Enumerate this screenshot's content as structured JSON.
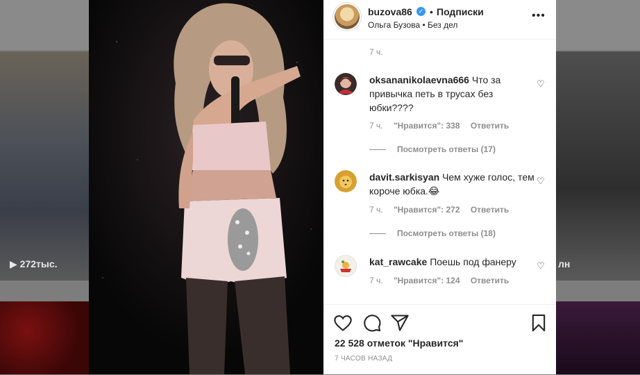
{
  "background": {
    "left_count": "272тыс.",
    "right_count": "лн"
  },
  "header": {
    "username": "buzova86",
    "separator": "•",
    "follow_label": "Подписки",
    "subtitle": "Ольга Бузова • Без дел",
    "more": "•••"
  },
  "comments": {
    "top_time": "7 ч.",
    "items": [
      {
        "user": "oksananikolaevna666",
        "text": "Что за привычка петь в трусах без юбки????",
        "time": "7 ч.",
        "likes": "\"Нравится\": 338",
        "reply": "Ответить",
        "view_replies": "Посмотреть ответы (17)"
      },
      {
        "user": "davit.sarkisyan",
        "text": "Чем хуже голос, тем короче юбка.😂",
        "time": "7 ч.",
        "likes": "\"Нравится\": 272",
        "reply": "Ответить",
        "view_replies": "Посмотреть ответы (18)"
      },
      {
        "user": "kat_rawcake",
        "text": "Поешь под фанеру",
        "time": "7 ч.",
        "likes": "\"Нравится\": 124",
        "reply": "Ответить"
      }
    ]
  },
  "footer": {
    "likes": "22 528 отметок \"Нравится\"",
    "posted": "7 ЧАСОВ НАЗАД"
  },
  "colors": {
    "text": "#262626",
    "muted": "#8e8e8e",
    "verified": "#3897f0"
  }
}
